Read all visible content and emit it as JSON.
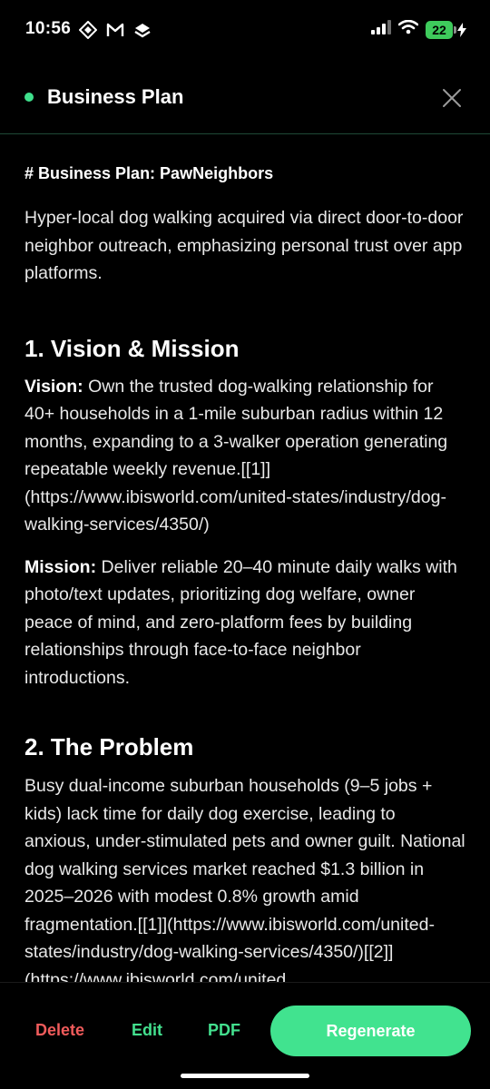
{
  "status_bar": {
    "time": "10:56",
    "battery_level": "22",
    "icons_left": [
      "app-diamond-icon",
      "gmail-icon",
      "stack-app-icon"
    ],
    "icons_right": [
      "cellular-signal-icon",
      "wifi-icon",
      "battery-charging-icon"
    ]
  },
  "header": {
    "title": "Business Plan",
    "status_color": "#3fe08c"
  },
  "document": {
    "h1": "# Business Plan: PawNeighbors",
    "intro": "Hyper-local dog walking acquired via direct door-to-door neighbor outreach, emphasizing personal trust over app platforms.",
    "sections": [
      {
        "heading": "1. Vision & Mission",
        "paragraphs": [
          {
            "label": "Vision:",
            "text": " Own the trusted dog-walking relationship for 40+ households in a 1-mile suburban radius within 12 months, expanding to a 3-walker operation generating repeatable weekly revenue.[[1]](https://www.ibisworld.com/united-states/industry/dog-walking-services/4350/)"
          },
          {
            "label": "Mission:",
            "text": " Deliver reliable 20–40 minute daily walks with photo/text updates, prioritizing dog welfare, owner peace of mind, and zero-platform fees by building relationships through face-to-face neighbor introductions."
          }
        ]
      },
      {
        "heading": "2. The Problem",
        "paragraphs": [
          {
            "text": "Busy dual-income suburban households (9–5 jobs + kids) lack time for daily dog exercise, leading to anxious, under-stimulated pets and owner guilt. National dog walking services market reached $1.3 billion in 2025–2026 with modest 0.8% growth amid fragmentation.[[1]](https://www.ibisworld.com/united-states/industry/dog-walking-services/4350/)[[2]](https://www.ibisworld.com/united"
          }
        ]
      }
    ]
  },
  "bottom_bar": {
    "delete_label": "Delete",
    "edit_label": "Edit",
    "pdf_label": "PDF",
    "regenerate_label": "Regenerate"
  },
  "colors": {
    "accent": "#41e38f",
    "danger": "#f05b5b",
    "background": "#000000"
  }
}
